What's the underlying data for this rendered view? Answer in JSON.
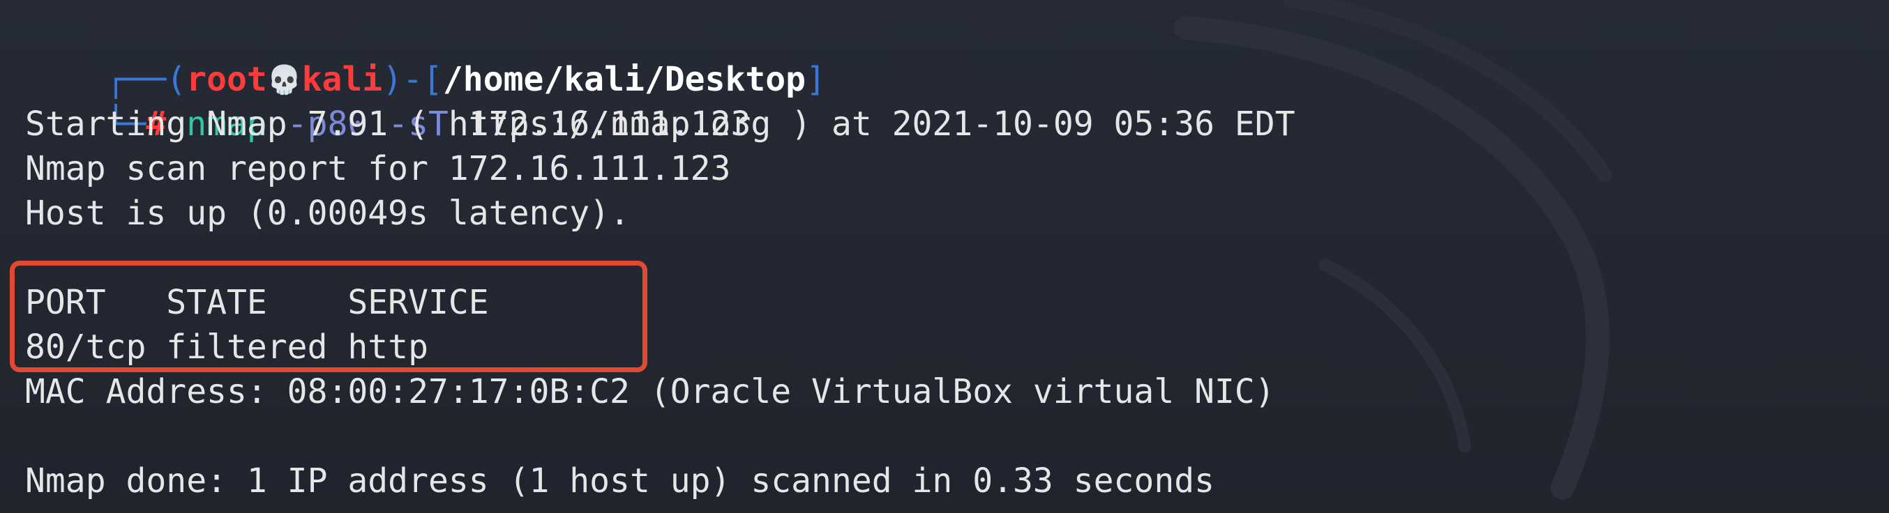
{
  "prompt": {
    "frame_open": "┌──(",
    "user": "root",
    "skull_icon": "💀",
    "host": "kali",
    "frame_mid": ")-[",
    "path": "/home/kali/Desktop",
    "frame_close": "]",
    "corner": "└─",
    "symbol": "#"
  },
  "command": {
    "program": "nmap",
    "flags": "-p80 -sT",
    "target": "172.16.111.123"
  },
  "output": {
    "line1": "Starting Nmap 7.91 ( https://nmap.org ) at 2021-10-09 05:36 EDT",
    "line2": "Nmap scan report for 172.16.111.123",
    "line3": "Host is up (0.00049s latency).",
    "table_header": "PORT   STATE    SERVICE",
    "table_row": "80/tcp filtered http",
    "mac": "MAC Address: 08:00:27:17:0B:C2 (Oracle VirtualBox virtual NIC)",
    "done": "Nmap done: 1 IP address (1 host up) scanned in 0.33 seconds"
  },
  "colors": {
    "background": "#232731",
    "prompt_frame": "#3a78d8",
    "prompt_user_host": "#ff3b3b",
    "command": "#30c7a2",
    "flags": "#7c8ad8",
    "highlight_border": "#e04a33",
    "text": "#e6e6e6"
  }
}
